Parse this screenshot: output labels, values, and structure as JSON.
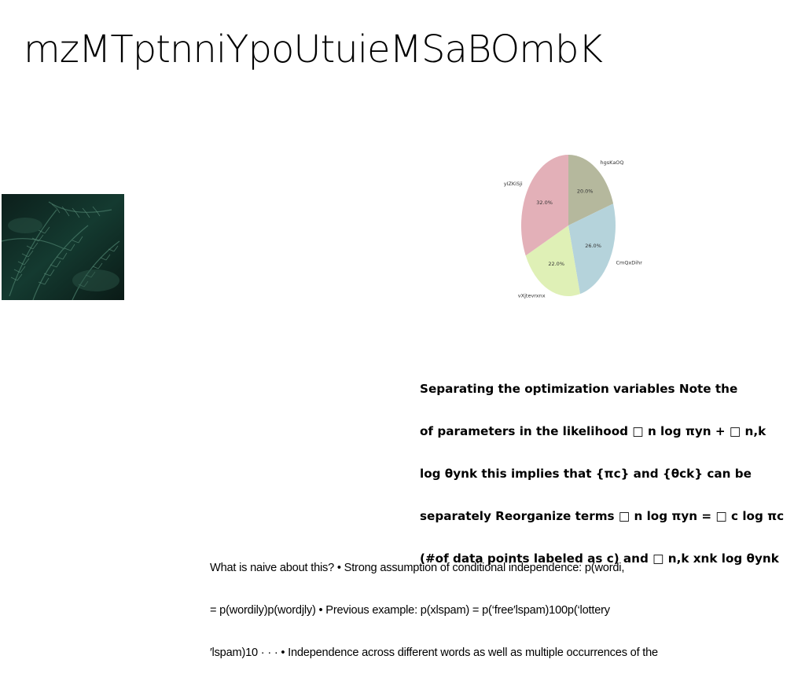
{
  "title": "mzMTptnniYpoUtuieMSaBOmbK",
  "paragraph_bold": {
    "lines": [
      "Separating the optimization variables Note the",
      "of parameters in the likelihood □ n log πyn + □ n,k",
      "log θynk this implies that {πc} and {θck} can be",
      "separately Reorganize terms □ n log πyn = □ c log πc",
      "(#of data points labeled as c) and □ n,k xnk log θynk"
    ]
  },
  "paragraph_plain": {
    "lines": [
      "What is naive about this? • Strong assumption of conditional independence: p(wordi,",
      "= p(wordily)p(wordjly) • Previous example: p(xlspam) = p(‘free′lspam)100p(‘lottery",
      "′lspam)10 · · · • Independence across different words as well as multiple occurrences of the"
    ]
  },
  "chart_data": {
    "type": "pie",
    "title": "",
    "slices": [
      {
        "label": "hgsKaOQ",
        "value": 20.0,
        "pct_label": "20.0%",
        "color": "#b5b89d"
      },
      {
        "label": "CmQxDihr",
        "value": 26.0,
        "pct_label": "26.0%",
        "color": "#b5d3db"
      },
      {
        "label": "vXjtevrxnx",
        "value": 22.0,
        "pct_label": "22.0%",
        "color": "#dff0b6"
      },
      {
        "label": "yIZKiSji",
        "value": 32.0,
        "pct_label": "32.0%",
        "color": "#e3b0b8"
      }
    ],
    "start_angle": "top (12 o'clock)",
    "direction": "clockwise"
  }
}
